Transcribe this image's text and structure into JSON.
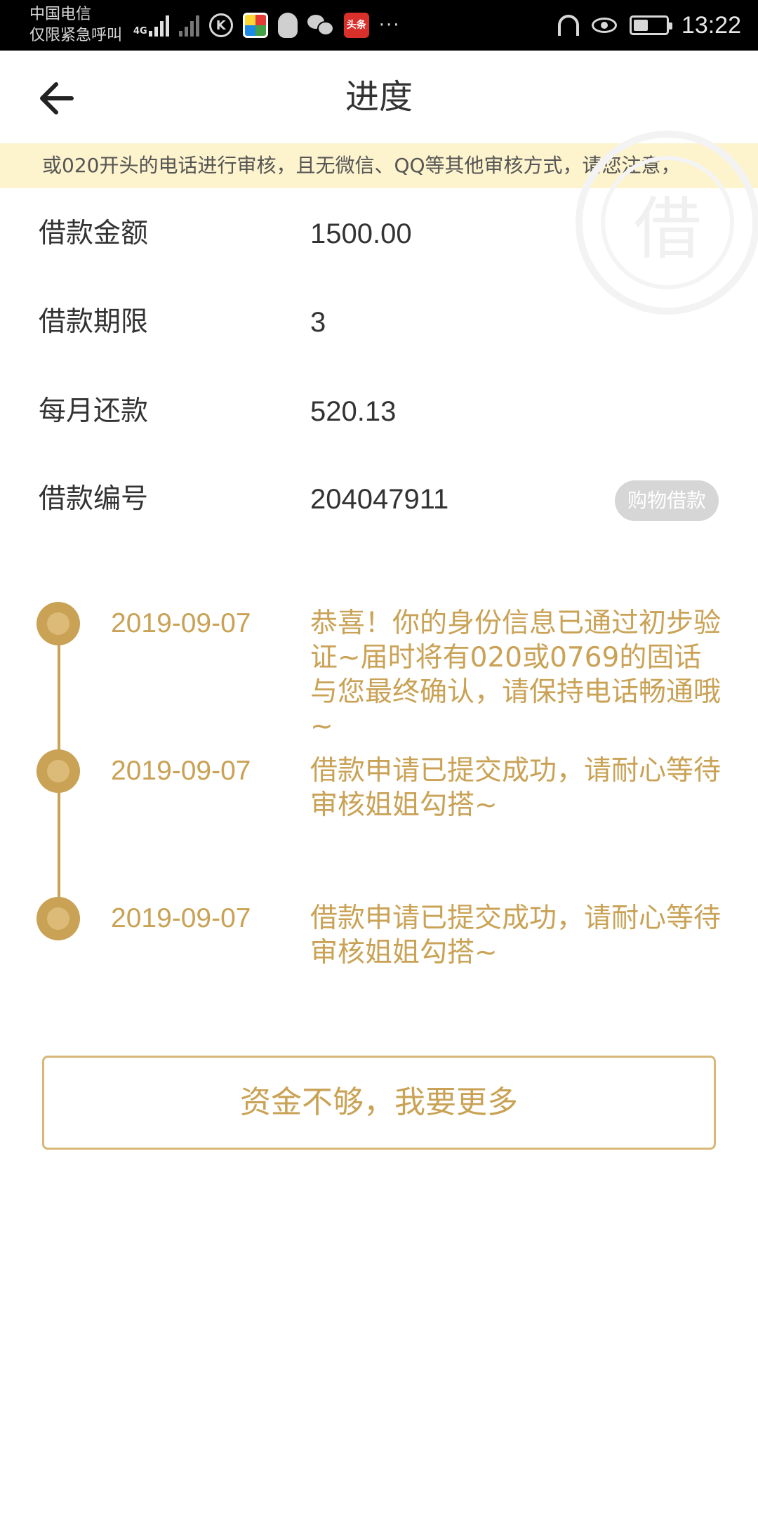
{
  "status_bar": {
    "carrier_line1": "中国电信",
    "carrier_line2": "仅限紧急呼叫",
    "network_type": "4G",
    "time": "13:22",
    "battery_level": 0.45,
    "app_icons": [
      "k-icon",
      "multicolor-app-icon",
      "qq-icon",
      "wechat-icon",
      "toutiao-icon"
    ],
    "toutiao_label": "头条",
    "more_indicator": "···"
  },
  "header": {
    "title": "进度"
  },
  "notice": {
    "text": "或020开头的电话进行审核，且无微信、QQ等其他审核方式，请您注意，"
  },
  "watermark": {
    "glyph": "借"
  },
  "loan_info": [
    {
      "label": "借款金额",
      "value": "1500.00"
    },
    {
      "label": "借款期限",
      "value": "3"
    },
    {
      "label": "每月还款",
      "value": "520.13"
    },
    {
      "label": "借款编号",
      "value": "204047911",
      "tag": "购物借款"
    }
  ],
  "timeline": [
    {
      "date": "2019-09-07",
      "text": "恭喜！你的身份信息已通过初步验证~届时将有020或0769的固话与您最终确认，请保持电话畅通哦~"
    },
    {
      "date": "2019-09-07",
      "text": "借款申请已提交成功，请耐心等待审核姐姐勾搭~"
    },
    {
      "date": "2019-09-07",
      "text": "借款申请已提交成功，请耐心等待审核姐姐勾搭~"
    }
  ],
  "action_button": {
    "label": "资金不够，我要更多"
  },
  "colors": {
    "accent": "#c9a255",
    "notice_bg": "#fdf3cd",
    "tag_bg": "#d6d6d6"
  }
}
